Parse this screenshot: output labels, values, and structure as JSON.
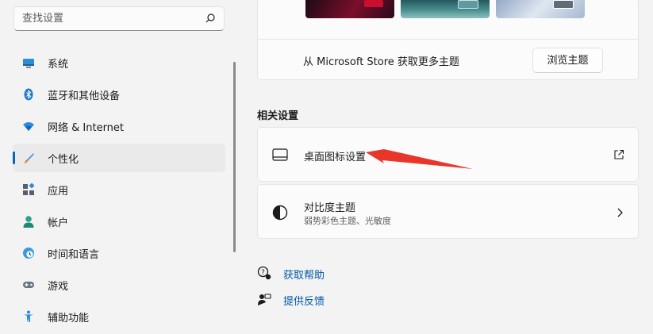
{
  "search": {
    "placeholder": "查找设置"
  },
  "sidebar": {
    "items": [
      {
        "label": "系统",
        "icon": "monitor-icon"
      },
      {
        "label": "蓝牙和其他设备",
        "icon": "bluetooth-icon"
      },
      {
        "label": "网络 & Internet",
        "icon": "wifi-icon"
      },
      {
        "label": "个性化",
        "icon": "brush-icon",
        "active": true
      },
      {
        "label": "应用",
        "icon": "apps-icon"
      },
      {
        "label": "帐户",
        "icon": "account-icon"
      },
      {
        "label": "时间和语言",
        "icon": "clock-globe-icon"
      },
      {
        "label": "游戏",
        "icon": "gamepad-icon"
      },
      {
        "label": "辅助功能",
        "icon": "accessibility-icon"
      }
    ]
  },
  "themes": {
    "store_text": "从 Microsoft Store 获取更多主题",
    "browse_button": "浏览主题"
  },
  "related": {
    "title": "相关设置",
    "desktop_icons": {
      "label": "桌面图标设置",
      "icon": "desktop-icon",
      "action_icon": "external-link-icon"
    },
    "contrast": {
      "label": "对比度主题",
      "subtitle": "弱势彩色主题、光敏度",
      "icon": "contrast-icon",
      "action_icon": "chevron-right-icon"
    }
  },
  "help": {
    "get_help": "获取帮助",
    "feedback": "提供反馈"
  },
  "colors": {
    "accent": "#0067c0",
    "link": "#0058a6",
    "annotation_arrow": "#e8362b"
  }
}
